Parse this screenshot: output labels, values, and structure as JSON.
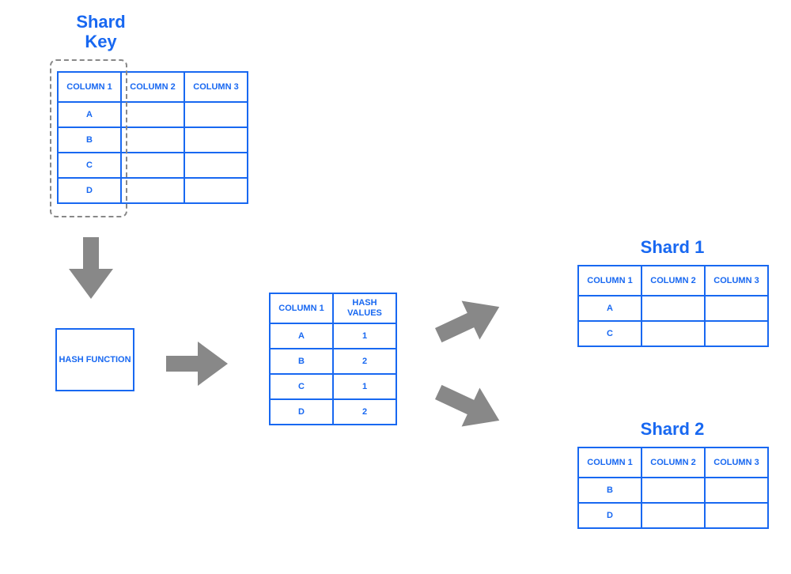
{
  "titles": {
    "shardKey": "Shard\nKey",
    "shard1": "Shard 1",
    "shard2": "Shard 2"
  },
  "originalTable": {
    "headers": [
      "COLUMN 1",
      "COLUMN 2",
      "COLUMN 3"
    ],
    "rows": [
      [
        "A",
        "",
        ""
      ],
      [
        "B",
        "",
        ""
      ],
      [
        "C",
        "",
        ""
      ],
      [
        "D",
        "",
        ""
      ]
    ]
  },
  "hashFunctionLabel": "HASH FUNCTION",
  "hashTable": {
    "headers": [
      "COLUMN 1",
      "HASH VALUES"
    ],
    "rows": [
      [
        "A",
        "1"
      ],
      [
        "B",
        "2"
      ],
      [
        "C",
        "1"
      ],
      [
        "D",
        "2"
      ]
    ]
  },
  "shard1Table": {
    "headers": [
      "COLUMN 1",
      "COLUMN 2",
      "COLUMN 3"
    ],
    "rows": [
      [
        "A",
        "",
        ""
      ],
      [
        "C",
        "",
        ""
      ]
    ]
  },
  "shard2Table": {
    "headers": [
      "COLUMN 1",
      "COLUMN 2",
      "COLUMN 3"
    ],
    "rows": [
      [
        "B",
        "",
        ""
      ],
      [
        "D",
        "",
        ""
      ]
    ]
  }
}
